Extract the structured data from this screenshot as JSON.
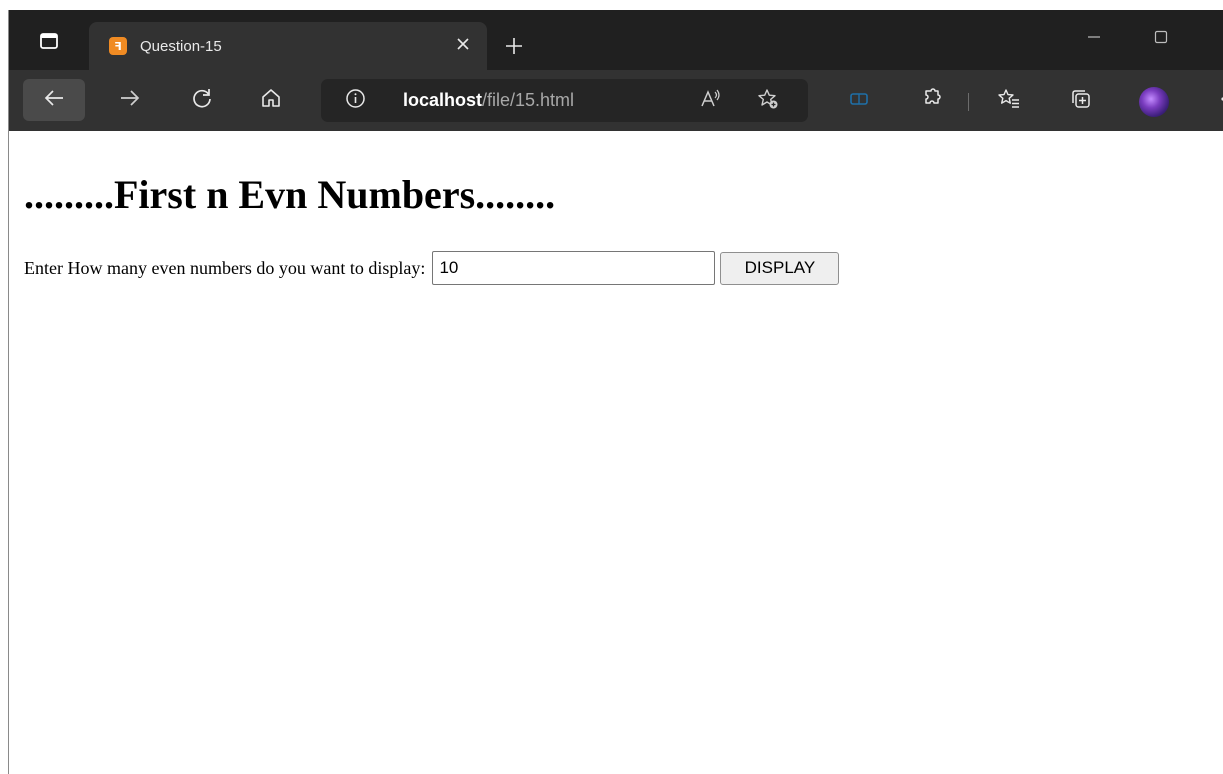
{
  "browser": {
    "tab": {
      "title": "Question-15",
      "favicon_text": "ꟻ"
    },
    "address": {
      "host": "localhost",
      "path": "/file/15.html"
    },
    "colors": {
      "titlebar": "#202020",
      "toolbar": "#323232",
      "tab_active": "#323232",
      "favicon": "#f08b23",
      "collections_accent": "#1e6fa8"
    },
    "icons": {
      "tab_actions": "tab-actions-icon",
      "close_tab": "close-icon",
      "new_tab": "plus-icon",
      "minimize": "minimize-icon",
      "maximize": "maximize-icon",
      "back": "back-arrow-icon",
      "forward": "forward-arrow-icon",
      "refresh": "refresh-icon",
      "home": "home-icon",
      "site_info": "info-icon",
      "read_aloud": "read-aloud-icon",
      "add_favorite": "add-favorite-icon",
      "extension": "extension-icon",
      "extensions": "puzzle-icon",
      "favorites": "favorites-icon",
      "collections": "collections-icon",
      "profile": "avatar"
    }
  },
  "page": {
    "heading": ".........First n Evn Numbers........",
    "form": {
      "label": "Enter How many even numbers do you want to display:",
      "input_value": "10",
      "button_label": "DISPLAY"
    }
  }
}
